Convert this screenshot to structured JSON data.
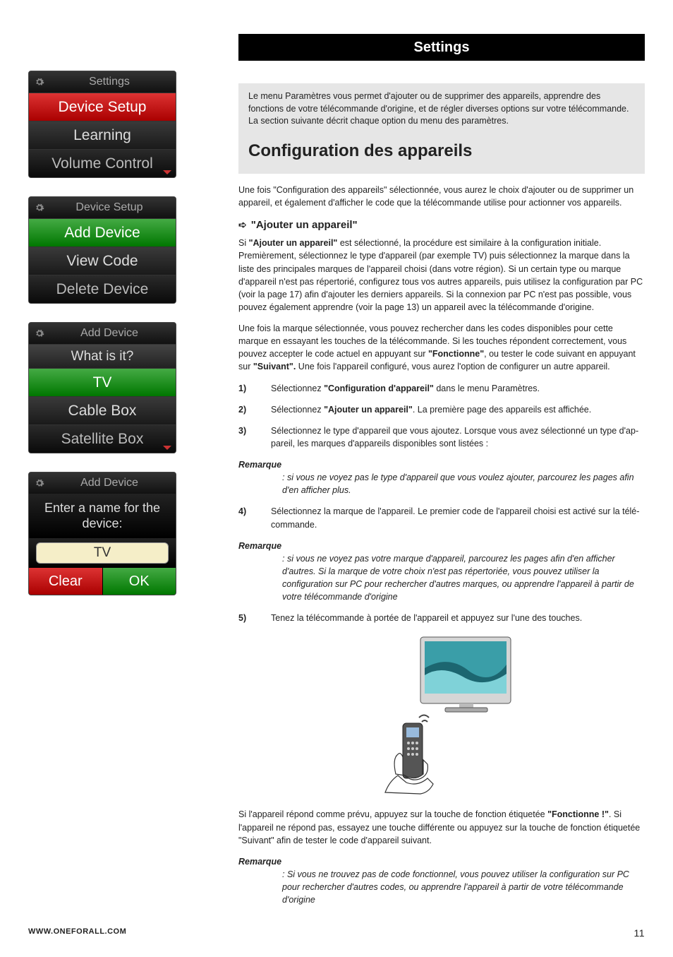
{
  "header": {
    "title": "Settings"
  },
  "panels": {
    "settings": {
      "title": "Settings",
      "items": [
        "Device Setup",
        "Learning",
        "Volume Control"
      ]
    },
    "device_setup": {
      "title": "Device Setup",
      "items": [
        "Add Device",
        "View Code",
        "Delete Device"
      ]
    },
    "add_device_type": {
      "title": "Add Device",
      "question": "What is it?",
      "items": [
        "TV",
        "Cable Box",
        "Satellite Box"
      ]
    },
    "add_device_name": {
      "title": "Add Device",
      "prompt": "Enter a name for the device:",
      "input_value": "TV",
      "clear": "Clear",
      "ok": "OK"
    }
  },
  "content": {
    "intro": "Le menu Paramètres vous permet d'ajouter ou de supprimer des appareils, apprendre des fonctions de votre télécommande d'origine, et de régler diverses options sur votre télécommande. La section suivante décrit chaque option du menu des paramètres.",
    "h2": "Configuration des appareils",
    "p_after_h2": "Une fois \"Configuration des appareils\" sélectionnée, vous aurez le choix d'ajouter ou de supprimer un appareil, et également d'afficher le code que la télécommande utilise pour actionner vos appareils.",
    "sub_h": "\"Ajouter un appareil\"",
    "p1_a": "Si ",
    "p1_b_bold": "\"Ajouter un appareil\"",
    "p1_c": " est sélectionné, la procédure est similaire à la configuration initiale. Premièrement, sélectionnez le type d'appareil (par exemple TV) puis sélectionnez la marque dans la liste des principales marques de l'appareil choisi (dans votre région). Si un certain type ou marque d'appareil n'est pas répertorié, configurez tous vos autres appareils, puis utilisez la configuration par PC (voir la page 17) afin d'ajouter les derniers appareils. Si la connexion par PC n'est pas possible, vous pouvez également apprendre (voir la page 13) un appareil avec la télécommande d'origine.",
    "p2_a": "Une fois la marque sélectionnée, vous pouvez rechercher dans les codes disponibles pour cette marque en essayant les touches de la télécommande. Si les touches répondent correctement, vous pouvez accepter le code actuel en appuyant sur ",
    "p2_b_bold": "\"Fonctionne\"",
    "p2_c": ", ou tester le code suivant en appuyant sur ",
    "p2_d_bold": "\"Suivant\".",
    "p2_e": " Une fois l'appareil configuré, vous aurez l'option de configurer un autre appareil.",
    "steps": [
      {
        "n": "1)",
        "a": "Sélectionnez ",
        "b": "\"Configuration d'appareil\"",
        "c": " dans le menu Paramètres."
      },
      {
        "n": "2)",
        "a": "Sélectionnez ",
        "b": "\"Ajouter un appareil\"",
        "c": ". La première page des appareils est affichée."
      },
      {
        "n": "3)",
        "a": "Sélectionnez le type d'appareil que vous ajoutez. Lorsque vous avez sélectionné un type d'ap­pareil, les marques d'appareils disponibles sont listées :",
        "b": "",
        "c": ""
      }
    ],
    "remark1_label": "Remarque",
    "remark1_text": ": si vous ne voyez pas le type d'appareil que vous voulez ajouter, parcourez les pages afin d'en afficher plus.",
    "step4": {
      "n": "4)",
      "t": "Sélectionnez la marque de l'appareil. Le premier code de l'appareil choisi est activé sur la télé­commande."
    },
    "remark2_label": "Remarque",
    "remark2_text": ": si vous ne voyez pas votre marque d'appareil, parcourez les pages afin d'en afficher d'autres.  Si la marque de votre choix n'est pas répertoriée, vous pouvez utiliser la configuration sur PC pour rechercher d'autres marques, ou apprendre l'appareil à partir de votre télécom­mande d'origine",
    "step5": {
      "n": "5)",
      "t": "Tenez la télécommande à portée de l'appareil et appuyez sur l'une des touches."
    },
    "p_after_img_a": "Si l'appareil répond comme prévu, appuyez sur la touche de fonction étiquetée ",
    "p_after_img_b_bold": "\"Fonctionne !\"",
    "p_after_img_c": ". Si l'appareil ne répond pas, essayez une touche différente ou appuyez sur la touche de fonction étiquetée \"Suivant\"  afin de tester le code d'appareil suivant.",
    "remark3_label": "Remarque",
    "remark3_text": ": Si vous ne trouvez pas de code fonctionnel, vous pouvez utiliser la configuration sur PC pour rechercher d'autres codes, ou apprendre l'appareil à partir de votre télécommande d'origine"
  },
  "footer": {
    "url": "WWW.ONEFORALL.COM",
    "page": "11"
  }
}
